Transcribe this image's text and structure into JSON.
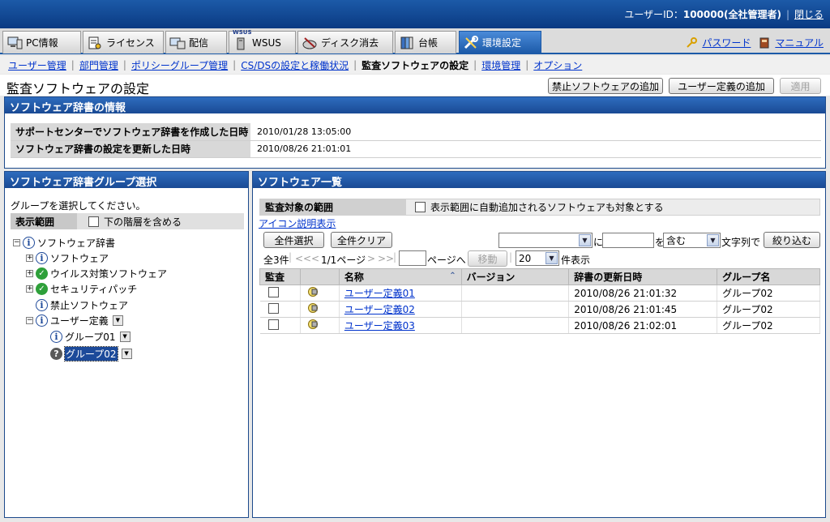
{
  "header": {
    "user_label": "ユーザーID：",
    "user_id": "100000(全社管理者)",
    "separator": "|",
    "close_label": "閉じる"
  },
  "menu": {
    "tabs": [
      {
        "label": "PC情報",
        "icon": "pc-icon"
      },
      {
        "label": "ライセンス",
        "icon": "license-icon"
      },
      {
        "label": "配信",
        "icon": "delivery-icon"
      },
      {
        "label": "WSUS",
        "icon": "wsus-icon"
      },
      {
        "label": "ディスク消去",
        "icon": "disk-erase-icon"
      },
      {
        "label": "台帳",
        "icon": "ledger-icon"
      },
      {
        "label": "環境設定",
        "icon": "settings-icon"
      }
    ],
    "wsus_badge": "WSUS",
    "password_link": "パスワード",
    "manual_link": "マニュアル"
  },
  "subnav": {
    "items": [
      "ユーザー管理",
      "部門管理",
      "ポリシーグループ管理",
      "CS/DSの設定と稼働状況",
      "監査ソフトウェアの設定",
      "環境管理",
      "オプション"
    ],
    "separator": "|"
  },
  "page": {
    "title": "監査ソフトウェアの設定",
    "btn_add_banned": "禁止ソフトウェアの追加",
    "btn_add_user_def": "ユーザー定義の追加",
    "btn_apply": "適用"
  },
  "dict_info": {
    "heading": "ソフトウェア辞書の情報",
    "rows": [
      {
        "label": "サポートセンターでソフトウェア辞書を作成した日時",
        "value": "2010/01/28 13:05:00"
      },
      {
        "label": "ソフトウェア辞書の設定を更新した日時",
        "value": "2010/08/26 21:01:01"
      }
    ]
  },
  "group_select": {
    "heading": "ソフトウェア辞書グループ選択",
    "instruction": "グループを選択してください。",
    "range_label": "表示範囲",
    "include_lower": "下の階層を含める",
    "tree": {
      "root": "ソフトウェア辞書",
      "software": "ソフトウェア",
      "antivirus": "ウイルス対策ソフトウェア",
      "security_patch": "セキュリティパッチ",
      "banned": "禁止ソフトウェア",
      "user_defined": "ユーザー定義",
      "group01": "グループ01",
      "group02": "グループ02"
    }
  },
  "software_list": {
    "heading": "ソフトウェア一覧",
    "scope_label": "監査対象の範囲",
    "scope_option": "表示範囲に自動追加されるソフトウェアも対象とする",
    "icon_help": "アイコン説明表示",
    "btn_select_all": "全件選択",
    "btn_clear_all": "全件クリア",
    "filter": {
      "field_value": "",
      "ni": "に",
      "text_value": "",
      "wo": "を",
      "match_value": "含む",
      "suffix": "文字列で",
      "btn": "絞り込む"
    },
    "pager": {
      "total": "全3件",
      "first": "<<",
      "prev": "<",
      "page_info": "1/1ページ",
      "next": ">",
      "last": ">>",
      "page_input": "",
      "goto_label": "ページへ",
      "btn_move": "移動",
      "per_page": "20",
      "per_page_suffix": "件表示"
    },
    "columns": [
      "監査",
      "",
      "名称",
      "バージョン",
      "辞書の更新日時",
      "グループ名"
    ],
    "rows": [
      {
        "name": "ユーザー定義01",
        "version": "",
        "updated": "2010/08/26 21:01:32",
        "group": "グループ02"
      },
      {
        "name": "ユーザー定義02",
        "version": "",
        "updated": "2010/08/26 21:01:45",
        "group": "グループ02"
      },
      {
        "name": "ユーザー定義03",
        "version": "",
        "updated": "2010/08/26 21:02:01",
        "group": "グループ02"
      }
    ]
  }
}
